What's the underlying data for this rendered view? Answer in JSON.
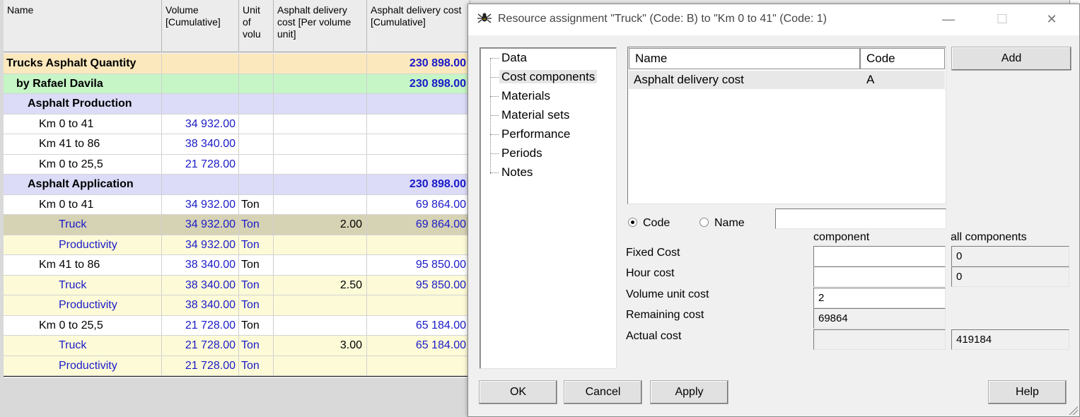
{
  "sheet": {
    "headers": {
      "name": "Name",
      "volume": "Volume [Cumulative]",
      "unit": "Unit of volu",
      "rate": "Asphalt delivery cost [Per volume unit]",
      "cumulative": "Asphalt delivery cost [Cumulative]"
    },
    "rows": [
      {
        "name": "Trucks Asphalt Quantity",
        "vol": "",
        "unit": "",
        "rate": "",
        "cum": "230 898.00"
      },
      {
        "name": "by Rafael Davila",
        "vol": "",
        "unit": "",
        "rate": "",
        "cum": "230 898.00"
      },
      {
        "name": "Asphalt Production",
        "vol": "",
        "unit": "",
        "rate": "",
        "cum": ""
      },
      {
        "name": "Km 0 to 41",
        "vol": "34 932.00",
        "unit": "",
        "rate": "",
        "cum": ""
      },
      {
        "name": "Km 41 to 86",
        "vol": "38 340.00",
        "unit": "",
        "rate": "",
        "cum": ""
      },
      {
        "name": "Km 0 to 25,5",
        "vol": "21 728.00",
        "unit": "",
        "rate": "",
        "cum": ""
      },
      {
        "name": "Asphalt Application",
        "vol": "",
        "unit": "",
        "rate": "",
        "cum": "230 898.00"
      },
      {
        "name": "Km 0 to 41",
        "vol": "34 932.00",
        "unit": "Ton",
        "rate": "",
        "cum": "69 864.00"
      },
      {
        "name": "Truck",
        "vol": "34 932.00",
        "unit": "Ton",
        "rate": "2.00",
        "cum": "69 864.00"
      },
      {
        "name": "Productivity",
        "vol": "34 932.00",
        "unit": "Ton",
        "rate": "",
        "cum": ""
      },
      {
        "name": "Km 41 to 86",
        "vol": "38 340.00",
        "unit": "Ton",
        "rate": "",
        "cum": "95 850.00"
      },
      {
        "name": "Truck",
        "vol": "38 340.00",
        "unit": "Ton",
        "rate": "2.50",
        "cum": "95 850.00"
      },
      {
        "name": "Productivity",
        "vol": "38 340.00",
        "unit": "Ton",
        "rate": "",
        "cum": ""
      },
      {
        "name": "Km 0 to 25,5",
        "vol": "21 728.00",
        "unit": "Ton",
        "rate": "",
        "cum": "65 184.00"
      },
      {
        "name": "Truck",
        "vol": "21 728.00",
        "unit": "Ton",
        "rate": "3.00",
        "cum": "65 184.00"
      },
      {
        "name": "Productivity",
        "vol": "21 728.00",
        "unit": "Ton",
        "rate": "",
        "cum": ""
      }
    ]
  },
  "dialog": {
    "icon": "spider-icon",
    "title": "Resource assignment \"Truck\" (Code: B) to \"Km 0 to 41\" (Code: 1)",
    "window_controls": {
      "minimize": "—",
      "maximize": "☐",
      "close": "✕"
    },
    "nav": [
      "Data",
      "Cost components",
      "Materials",
      "Material sets",
      "Performance",
      "Periods",
      "Notes"
    ],
    "list": {
      "headers": [
        "Name",
        "Code"
      ],
      "rows": [
        {
          "name": "Asphalt delivery cost",
          "code": "A"
        }
      ]
    },
    "add_label": "Add",
    "search": {
      "code_label": "Code",
      "name_label": "Name",
      "value": ""
    },
    "columns": {
      "component": "component",
      "all": "all components"
    },
    "fields": {
      "fixed_cost": {
        "label": "Fixed Cost",
        "component": "",
        "all": "0"
      },
      "hour_cost": {
        "label": "Hour cost",
        "component": "",
        "all": "0"
      },
      "volume_unit_cost": {
        "label": "Volume unit cost",
        "component": "2"
      },
      "remaining_cost": {
        "label": "Remaining cost",
        "component": "69864"
      },
      "actual_cost": {
        "label": "Actual cost",
        "component": "",
        "all": "419184"
      }
    },
    "buttons": {
      "ok": "OK",
      "cancel": "Cancel",
      "apply": "Apply",
      "help": "Help"
    }
  }
}
